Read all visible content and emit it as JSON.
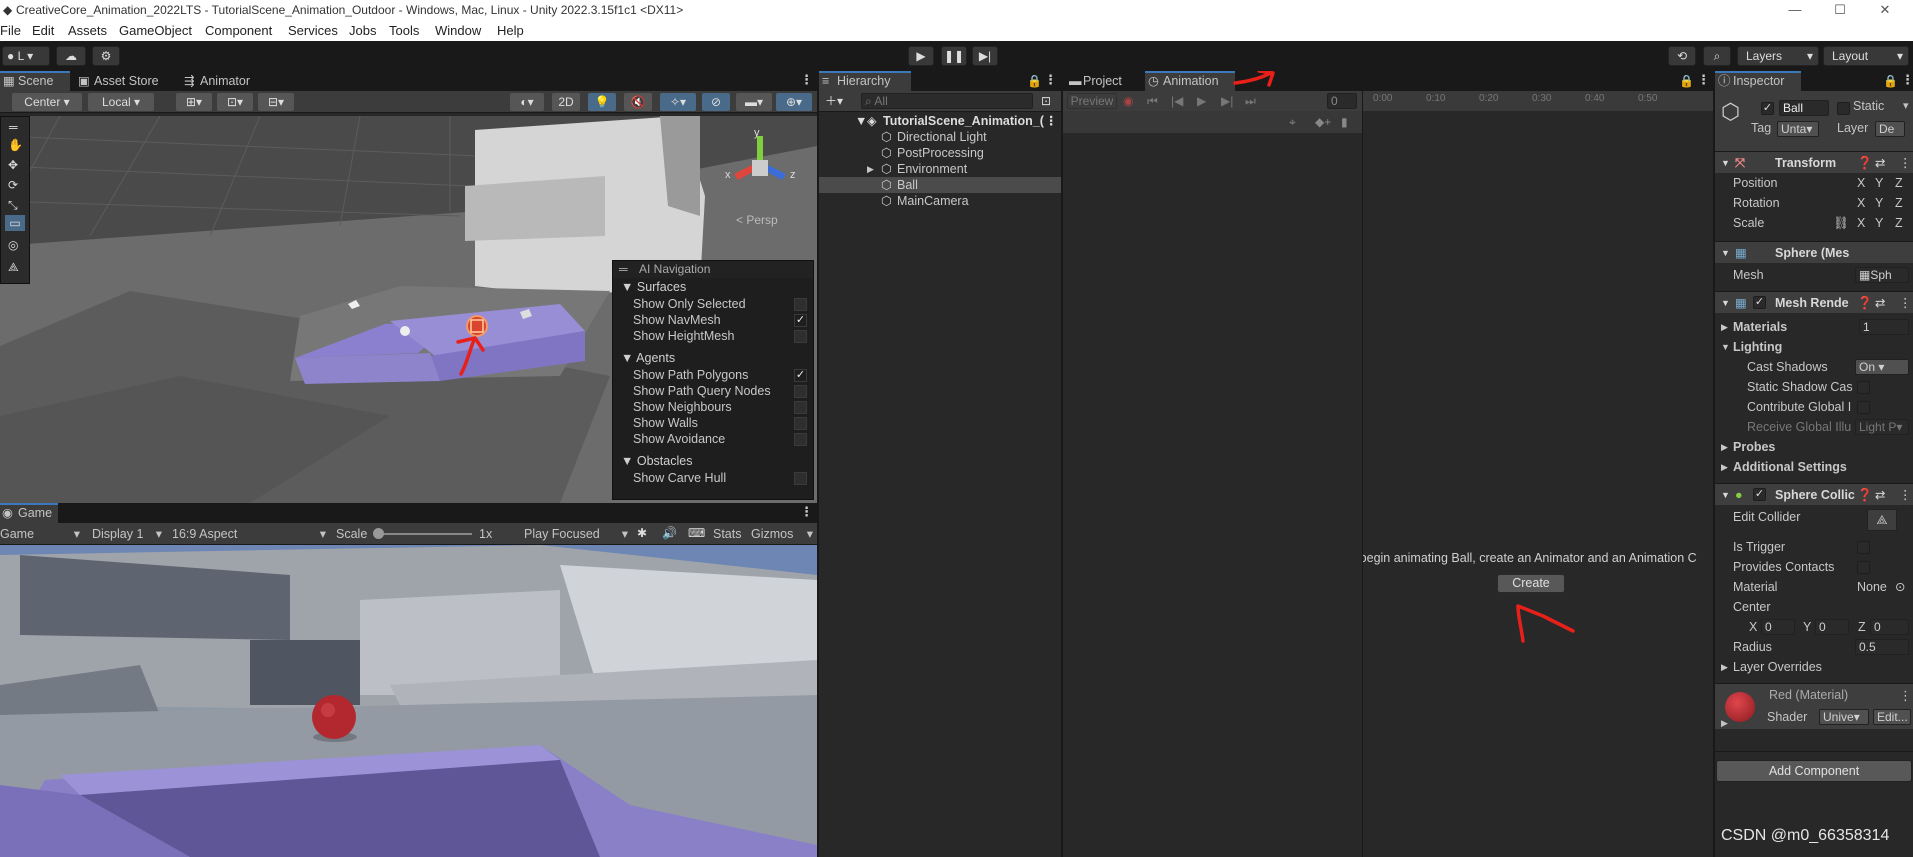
{
  "window": {
    "title": "CreativeCore_Animation_2022LTS - TutorialScene_Animation_Outdoor - Windows, Mac, Linux - Unity 2022.3.15f1c1 <DX11>",
    "minimize": "—",
    "maximize": "☐",
    "close": "✕"
  },
  "menu": [
    "File",
    "Edit",
    "Assets",
    "GameObject",
    "Component",
    "Services",
    "Jobs",
    "Tools",
    "Window",
    "Help"
  ],
  "toolbar": {
    "account": "L",
    "layers": "Layers",
    "layout": "Layout"
  },
  "scene": {
    "tabs": [
      "Scene",
      "Asset Store",
      "Animator"
    ],
    "pivot": "Center",
    "space": "Local",
    "mode_2d": "2D",
    "persp_label": "< Persp",
    "nav": {
      "title": "AI Navigation",
      "surfaces": "Surfaces",
      "show_only_selected": "Show Only Selected",
      "show_navmesh": "Show NavMesh",
      "show_heightmesh": "Show HeightMesh",
      "agents": "Agents",
      "show_path_polygons": "Show Path Polygons",
      "show_path_query_nodes": "Show Path Query Nodes",
      "show_neighbours": "Show Neighbours",
      "show_walls": "Show Walls",
      "show_avoidance": "Show Avoidance",
      "obstacles": "Obstacles",
      "show_carve_hull": "Show Carve Hull",
      "checks": {
        "show_only_selected": false,
        "show_navmesh": true,
        "show_heightmesh": false,
        "show_path_polygons": true,
        "show_path_query_nodes": false,
        "show_neighbours": false,
        "show_walls": false,
        "show_avoidance": false,
        "show_carve_hull": false
      }
    }
  },
  "game": {
    "tab": "Game",
    "mode": "Game",
    "display": "Display 1",
    "aspect": "16:9 Aspect",
    "scale_label": "Scale",
    "scale_value": "1x",
    "play_focused": "Play Focused",
    "stats": "Stats",
    "gizmos": "Gizmos"
  },
  "hierarchy": {
    "tab": "Hierarchy",
    "search_placeholder": "All",
    "scene_name": "TutorialScene_Animation_(",
    "items": [
      "Directional Light",
      "PostProcessing",
      "Environment",
      "Ball",
      "MainCamera"
    ]
  },
  "animation": {
    "tabs": [
      "Project",
      "Animation"
    ],
    "preview": "Preview",
    "frame": "0",
    "ruler": [
      "0:00",
      "0:10",
      "0:20",
      "0:30",
      "0:40",
      "0:50"
    ],
    "message": "To begin animating Ball, create an Animator and an Animation C",
    "create": "Create"
  },
  "inspector": {
    "tab": "Inspector",
    "name": "Ball",
    "static": "Static",
    "tag_label": "Tag",
    "tag_value": "Unta",
    "layer_label": "Layer",
    "layer_value": "De",
    "transform": {
      "title": "Transform",
      "position": "Position",
      "rotation": "Rotation",
      "scale": "Scale",
      "x": "X",
      "y": "Y",
      "z": "Z"
    },
    "mesh_filter": {
      "title": "Sphere (Mes",
      "mesh_label": "Mesh",
      "mesh_value": "Sph"
    },
    "mesh_renderer": {
      "title": "Mesh Rende",
      "materials": "Materials",
      "materials_count": "1",
      "lighting": "Lighting",
      "cast_shadows": "Cast Shadows",
      "cast_shadows_value": "On",
      "static_shadow": "Static Shadow Cas",
      "contribute_gi": "Contribute Global I",
      "receive_gi": "Receive Global Illu",
      "receive_gi_value": "Light P",
      "probes": "Probes",
      "additional": "Additional Settings"
    },
    "collider": {
      "title": "Sphere Collic",
      "edit_collider": "Edit Collider",
      "is_trigger": "Is Trigger",
      "provides_contacts": "Provides Contacts",
      "material": "Material",
      "material_value": "None",
      "center": "Center",
      "cx": "0",
      "cy": "0",
      "cz": "0",
      "radius": "Radius",
      "radius_value": "0.5",
      "layer_overrides": "Layer Overrides"
    },
    "material": {
      "name": "Red (Material)",
      "shader_label": "Shader",
      "shader_value": "Unive",
      "edit": "Edit..."
    },
    "add_component": "Add Component"
  },
  "watermark": "CSDN @m0_66358314",
  "colors": {
    "accent": "#3a79bb",
    "annotation": "#e8201a",
    "navmesh": "#8b80cf"
  }
}
